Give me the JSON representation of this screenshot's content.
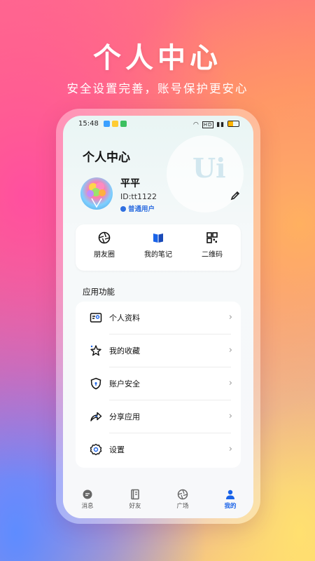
{
  "hero": {
    "title": "个人中心",
    "subtitle": "安全设置完善，账号保护更安心"
  },
  "status_bar": {
    "time": "15:48",
    "signal_text": "HD"
  },
  "page": {
    "title": "个人中心",
    "deco_text": "Ui"
  },
  "profile": {
    "name": "平平",
    "id": "ID:tt1122",
    "level": "普通用户"
  },
  "quick_actions": [
    {
      "label": "朋友圈",
      "icon": "aperture-icon"
    },
    {
      "label": "我的笔记",
      "icon": "book-icon"
    },
    {
      "label": "二维码",
      "icon": "qrcode-icon"
    }
  ],
  "section": {
    "title": "应用功能"
  },
  "menu": [
    {
      "label": "个人资料",
      "icon": "profile-card-icon"
    },
    {
      "label": "我的收藏",
      "icon": "star-icon"
    },
    {
      "label": "账户安全",
      "icon": "shield-icon"
    },
    {
      "label": "分享应用",
      "icon": "share-icon"
    },
    {
      "label": "设置",
      "icon": "gear-icon"
    }
  ],
  "tabs": [
    {
      "label": "消息",
      "icon": "message-icon"
    },
    {
      "label": "好友",
      "icon": "contacts-icon"
    },
    {
      "label": "广场",
      "icon": "aperture-icon"
    },
    {
      "label": "我的",
      "icon": "person-icon",
      "active": true
    }
  ],
  "colors": {
    "accent": "#1a63e8",
    "level_badge": "#2f6fe0"
  }
}
